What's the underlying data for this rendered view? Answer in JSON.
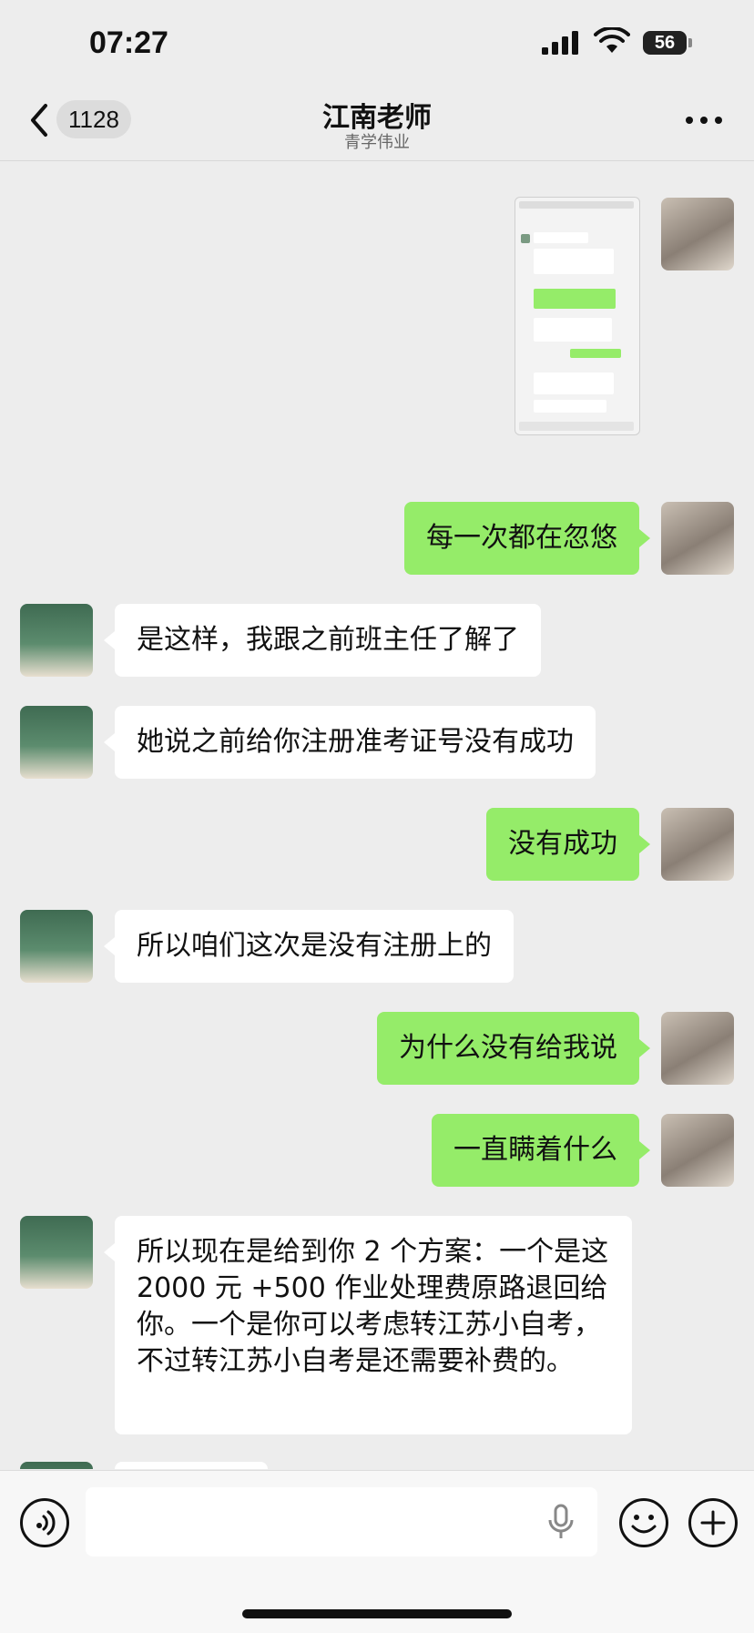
{
  "status_bar": {
    "time": "07:27",
    "battery": "56"
  },
  "nav": {
    "unread_count": "1128",
    "title": "江南老师",
    "subtitle": "青学伟业"
  },
  "messages": [
    {
      "from": "self",
      "type": "image",
      "text": ""
    },
    {
      "from": "self",
      "text": "每一次都在忽悠"
    },
    {
      "from": "teacher",
      "text": "是这样，我跟之前班主任了解了"
    },
    {
      "from": "teacher",
      "text": "她说之前给你注册准考证号没有成功"
    },
    {
      "from": "self",
      "text": "没有成功"
    },
    {
      "from": "teacher",
      "text": "所以咱们这次是没有注册上的"
    },
    {
      "from": "self",
      "text": "为什么没有给我说"
    },
    {
      "from": "self",
      "text": "一直瞒着什么"
    },
    {
      "from": "teacher",
      "text": "所以现在是给到你 2 个方案：一个是这 2000 元 +500 作业处理费原路退回给你。一个是你可以考虑转江苏小自考，不过转江苏小自考是还需要补费的。"
    }
  ],
  "colors": {
    "self_bubble": "#95ec69",
    "other_bubble": "#ffffff",
    "background": "#ededed"
  },
  "icons": [
    "back-icon",
    "more-icon",
    "voice-icon",
    "microphone-icon",
    "emoji-icon",
    "plus-icon",
    "signal-icon",
    "wifi-icon"
  ]
}
